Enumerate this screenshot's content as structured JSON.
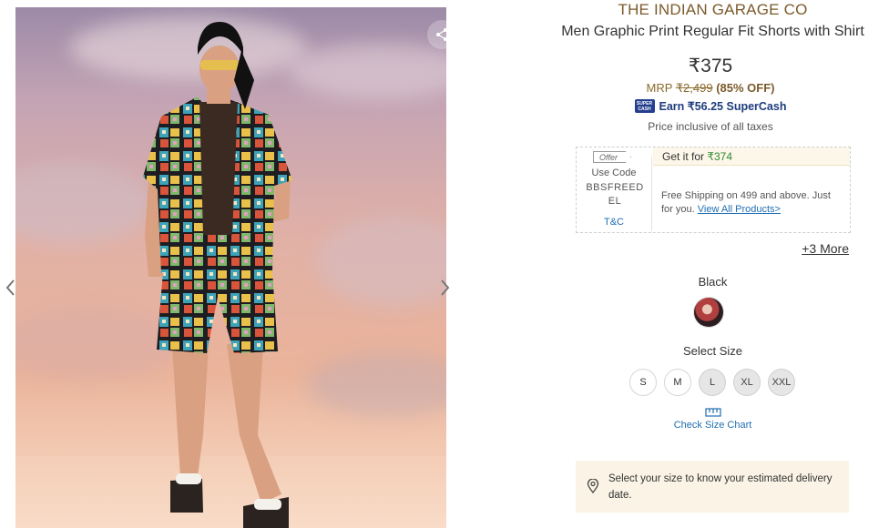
{
  "product": {
    "brand": "THE INDIAN GARAGE CO",
    "title": "Men Graphic Print Regular Fit Shorts with Shirt",
    "price": "₹375",
    "mrp_label": "MRP",
    "mrp_value": "₹2,499",
    "discount": "(85% OFF)",
    "supercash_badge_top": "SUPER",
    "supercash_badge_bottom": "CASH",
    "supercash_text": "Earn ₹56.25 SuperCash",
    "taxes_note": "Price inclusive of all taxes"
  },
  "offer": {
    "tag": "Offer",
    "use_code_label": "Use Code",
    "code": "BBSFREEDEL",
    "tnc": "T&C",
    "get_it_label": "Get it for",
    "get_it_price": "₹374",
    "shipping_text": "Free Shipping on 499 and above. Just for you.",
    "shipping_link": "View All Products>"
  },
  "more_offers": "+3 More",
  "color": {
    "label": "Black",
    "swatch_icon": "color-swatch-black"
  },
  "size": {
    "label": "Select Size",
    "options": [
      "S",
      "M",
      "L",
      "XL",
      "XXL"
    ],
    "out_of_stock": [
      false,
      false,
      true,
      true,
      true
    ],
    "chart_link": "Check Size Chart"
  },
  "delivery": {
    "text": "Select your size to know your estimated delivery date."
  },
  "icons": {
    "prev": "chevron-left-icon",
    "next": "chevron-right-icon",
    "share": "share-icon",
    "ruler": "ruler-icon",
    "location": "location-pin-icon"
  },
  "colors": {
    "brand": "#7b5a2a",
    "link": "#1f6fb2",
    "supercash": "#1e3c7d",
    "offer_price": "#2e8b2e",
    "delivery_bg": "#fbf4e6"
  }
}
